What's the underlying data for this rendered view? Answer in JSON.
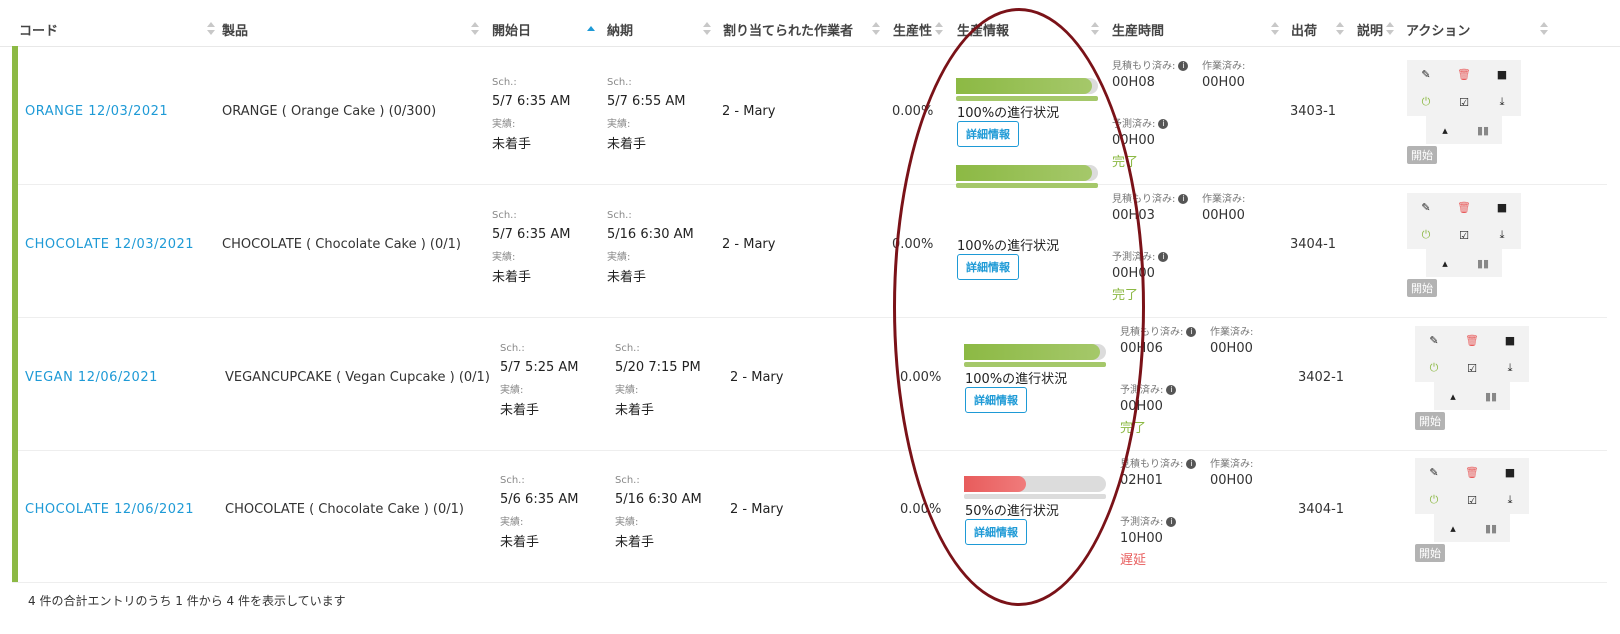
{
  "headers": {
    "code": "コード",
    "product": "製品",
    "start": "開始日",
    "due": "納期",
    "worker": "割り当てられた作業者",
    "productivity": "生産性",
    "prodinfo": "生産情報",
    "prodtime": "生産時間",
    "ship": "出荷",
    "desc": "説明",
    "action": "アクション"
  },
  "labels": {
    "sch": "Sch.:",
    "actual": "実績:",
    "estimate": "見積もり済み:",
    "worked": "作業済み:",
    "predicted": "予測済み:",
    "details": "詳細情報",
    "start_btn": "開始"
  },
  "rows": [
    {
      "code": "ORANGE 12/03/2021",
      "product": "ORANGE ( Orange Cake ) (0/300)",
      "start_sch": "5/7   6:35 AM",
      "start_act": "未着手",
      "due_sch": "5/7   6:55 AM",
      "due_act": "未着手",
      "worker": "2 - Mary",
      "productivity": "0.00%",
      "progress": 100,
      "progress_label": "100%の進行状況",
      "estimate": "00H08",
      "worked": "00H00",
      "predicted": "00H00",
      "status": "完了",
      "ship": "3403-1"
    },
    {
      "code": "CHOCOLATE 12/03/2021",
      "product": "CHOCOLATE ( Chocolate Cake ) (0/1)",
      "start_sch": "5/7   6:35 AM",
      "start_act": "未着手",
      "due_sch": "5/16   6:30 AM",
      "due_act": "未着手",
      "worker": "2 - Mary",
      "productivity": "0.00%",
      "progress": 100,
      "progress_label": "100%の進行状況",
      "estimate": "00H03",
      "worked": "00H00",
      "predicted": "00H00",
      "status": "完了",
      "ship": "3404-1"
    },
    {
      "code": "VEGAN 12/06/2021",
      "product": "VEGANCUPCAKE ( Vegan Cupcake ) (0/1)",
      "start_sch": "5/7   5:25 AM",
      "start_act": "未着手",
      "due_sch": "5/20   7:15 PM",
      "due_act": "未着手",
      "worker": "2 - Mary",
      "productivity": "0.00%",
      "progress": 100,
      "progress_label": "100%の進行状況",
      "estimate": "00H06",
      "worked": "00H00",
      "predicted": "00H00",
      "status": "完了",
      "ship": "3402-1"
    },
    {
      "code": "CHOCOLATE 12/06/2021",
      "product": "CHOCOLATE ( Chocolate Cake ) (0/1)",
      "start_sch": "5/6   6:35 AM",
      "start_act": "未着手",
      "due_sch": "5/16   6:30 AM",
      "due_act": "未着手",
      "worker": "2 - Mary",
      "productivity": "0.00%",
      "progress": 50,
      "progress_label": "50%の進行状況",
      "estimate": "02H01",
      "worked": "00H00",
      "predicted": "10H00",
      "status": "遅延",
      "ship": "3404-1"
    }
  ],
  "footer": "4 件の合計エントリのうち 1 件から 4 件を表示しています",
  "colors": {
    "accent": "#1e9ad6",
    "done": "#8cb944",
    "late": "#e85c5c",
    "annotation": "#7a1218"
  },
  "icons": [
    "edit-icon",
    "delete-icon",
    "document-icon",
    "power-icon",
    "check-icon",
    "download-icon",
    "hierarchy-icon",
    "barcode-icon"
  ]
}
